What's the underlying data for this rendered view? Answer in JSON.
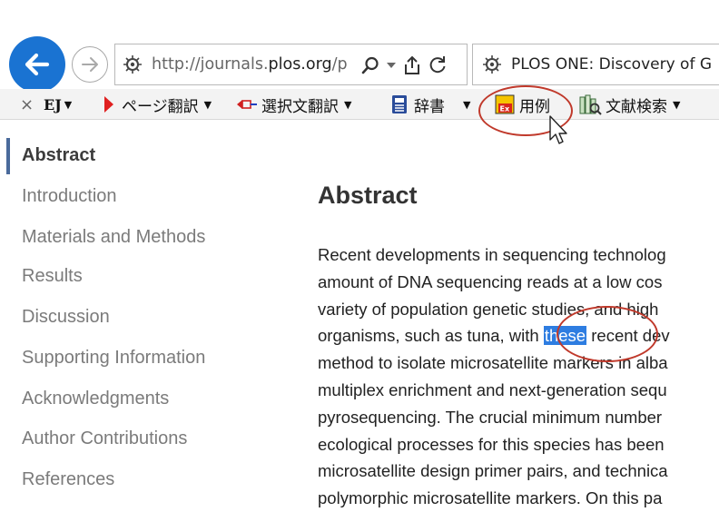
{
  "browser": {
    "url_prefix": "http://journals.",
    "url_domain": "plos.org",
    "url_suffix": "/p",
    "tab_title": "PLOS ONE: Discovery of G"
  },
  "toolbar": {
    "close_symbol": "×",
    "ej_label": "EJ",
    "page_translate_label": "ページ翻訳",
    "selection_translate_label": "選択文翻訳",
    "dictionary_label": "辞書",
    "examples_label": "用例",
    "literature_search_label": "文献検索"
  },
  "sidebar": {
    "items": [
      {
        "label": "Abstract"
      },
      {
        "label": "Introduction"
      },
      {
        "label": "Materials and Methods"
      },
      {
        "label": "Results"
      },
      {
        "label": "Discussion"
      },
      {
        "label": "Supporting Information"
      },
      {
        "label": "Acknowledgments"
      },
      {
        "label": "Author Contributions"
      },
      {
        "label": "References"
      }
    ]
  },
  "main": {
    "heading": "Abstract",
    "lines": [
      "Recent developments in sequencing technolog",
      "amount of DNA sequencing reads at a low cos",
      "variety of population genetic studies, and high",
      "organisms, such as tuna, with ",
      "method to isolate microsatellite markers in alba",
      "multiplex enrichment and next-generation sequ",
      "pyrosequencing. The crucial minimum number",
      "ecological processes for this species has been",
      "microsatellite design primer pairs, and technica",
      "polymorphic microsatellite markers. On this pa"
    ],
    "highlight_word": "these",
    "line4_tail": " recent dev"
  },
  "colors": {
    "back_button": "#1a73d2",
    "selection_highlight": "#2e7de1",
    "annotation_ring": "#c0392b",
    "active_sidebar_bar": "#4a6a9b"
  }
}
